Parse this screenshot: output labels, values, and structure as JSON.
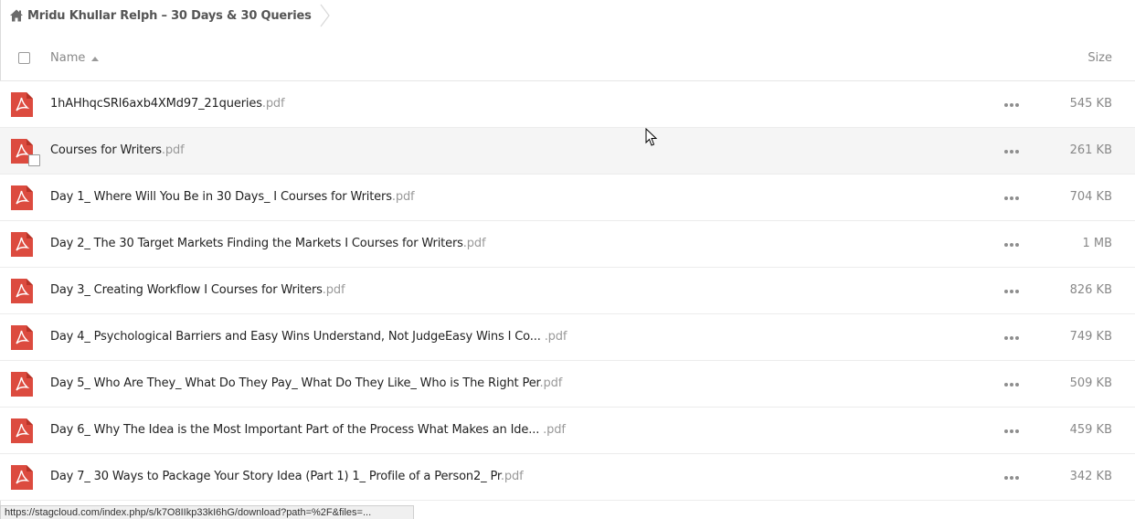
{
  "breadcrumb": {
    "home_icon": "home-icon",
    "label": "Mridu Khullar Relph – 30 Days & 30 Queries"
  },
  "header": {
    "name_label": "Name",
    "size_label": "Size",
    "sort_icon": "sort-ascending-icon"
  },
  "files": [
    {
      "name": "1hAHhqcSRl6axb4XMd97_21queries",
      "ext": ".pdf",
      "size": "545 KB"
    },
    {
      "name": "Courses for Writers",
      "ext": ".pdf",
      "size": "261 KB"
    },
    {
      "name": "Day 1_ Where Will You Be in 30 Days_ I Courses for Writers",
      "ext": ".pdf",
      "size": "704 KB"
    },
    {
      "name": "Day 2_ The 30 Target Markets Finding the Markets I Courses for Writers",
      "ext": ".pdf",
      "size": "1 MB"
    },
    {
      "name": "Day 3_ Creating Workflow I Courses for Writers",
      "ext": ".pdf",
      "size": "826 KB"
    },
    {
      "name": "Day 4_ Psychological Barriers and Easy Wins Understand, Not JudgeEasy Wins I Co... ",
      "ext": ".pdf",
      "size": "749 KB"
    },
    {
      "name": "Day 5_ Who Are They_ What Do They Pay_ What Do They Like_ Who is The Right Per",
      "ext": ".pdf",
      "size": "509 KB"
    },
    {
      "name": "Day 6_ Why The Idea is the Most Important Part of the Process What Makes an Ide... ",
      "ext": ".pdf",
      "size": "459 KB"
    },
    {
      "name": "Day 7_ 30 Ways to Package Your Story Idea (Part 1) 1_ Profile of a Person2_ Pr",
      "ext": ".pdf",
      "size": "342 KB"
    }
  ],
  "file_icon": "pdf-file-icon",
  "actions_icon": "more-actions-icon",
  "status_url": "https://stagcloud.com/index.php/s/k7O8IIkp33kI6hG/download?path=%2F&files=...",
  "colors": {
    "pdf_red": "#dc4b3f",
    "hover_row": "#f5f5f5",
    "muted_text": "#888888"
  }
}
